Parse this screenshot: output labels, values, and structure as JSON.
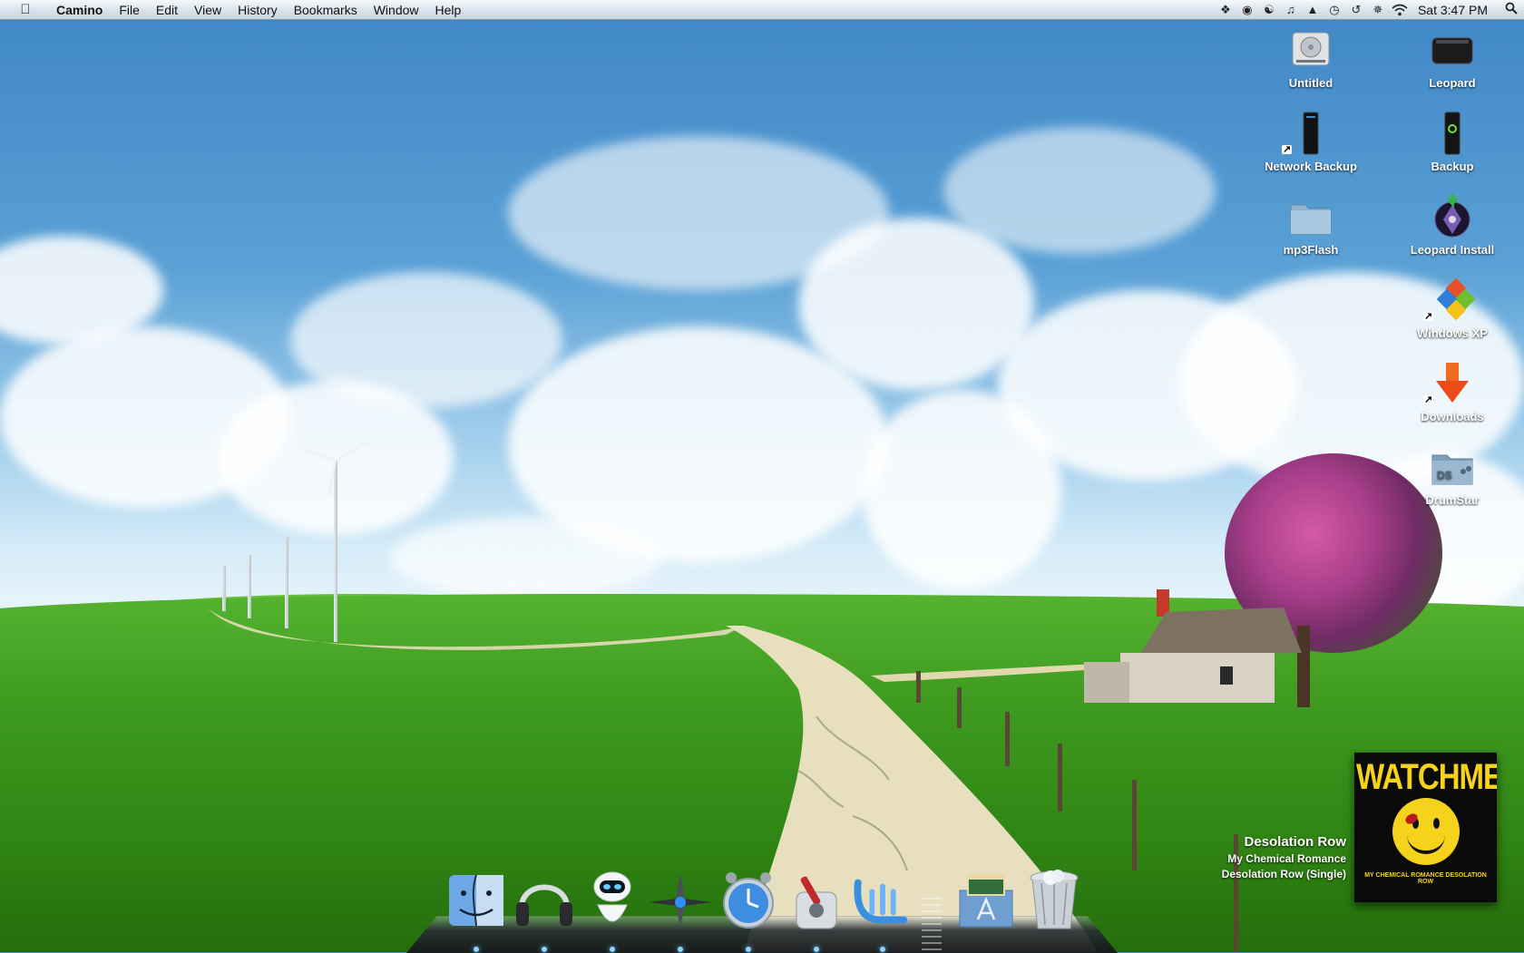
{
  "menubar": {
    "app_name": "Camino",
    "menus": [
      "File",
      "Edit",
      "View",
      "History",
      "Bookmarks",
      "Window",
      "Help"
    ],
    "status_icons": [
      "dropbox-icon",
      "growl-icon",
      "yinyang-icon",
      "music-note-icon",
      "broom-icon",
      "alarm-clock-icon",
      "time-machine-icon",
      "bluetooth-icon",
      "wifi-icon"
    ],
    "clock": "Sat 3:47 PM"
  },
  "desktop_icons": [
    {
      "label": "Untitled",
      "icon": "hard-drive-icon"
    },
    {
      "label": "Leopard",
      "icon": "external-drive-icon"
    },
    {
      "label": "Network Backup",
      "icon": "network-drive-alias-icon"
    },
    {
      "label": "Backup",
      "icon": "backup-drive-icon"
    },
    {
      "label": "mp3Flash",
      "icon": "folder-icon"
    },
    {
      "label": "Leopard Install",
      "icon": "install-disc-icon"
    },
    {
      "label": "Windows XP",
      "icon": "windows-alias-icon"
    },
    {
      "label": "Downloads",
      "icon": "downloads-alias-icon"
    },
    {
      "label": "DrumStar",
      "icon": "drumstar-folder-icon"
    }
  ],
  "now_playing": {
    "title": "Desolation Row",
    "artist": "My Chemical Romance",
    "album": "Desolation Row (Single)",
    "art_text": "WATCHMEN",
    "art_caption": "MY CHEMICAL ROMANCE DESOLATION ROW"
  },
  "dock": [
    "finder-icon",
    "headphones-icon",
    "eve-robot-icon",
    "compass-icon",
    "clock-icon",
    "activity-monitor-icon",
    "word-icon",
    "applications-stack-icon",
    "trash-icon"
  ],
  "colors": {
    "accent": "#3f86c6",
    "grass": "#3f9b20"
  }
}
